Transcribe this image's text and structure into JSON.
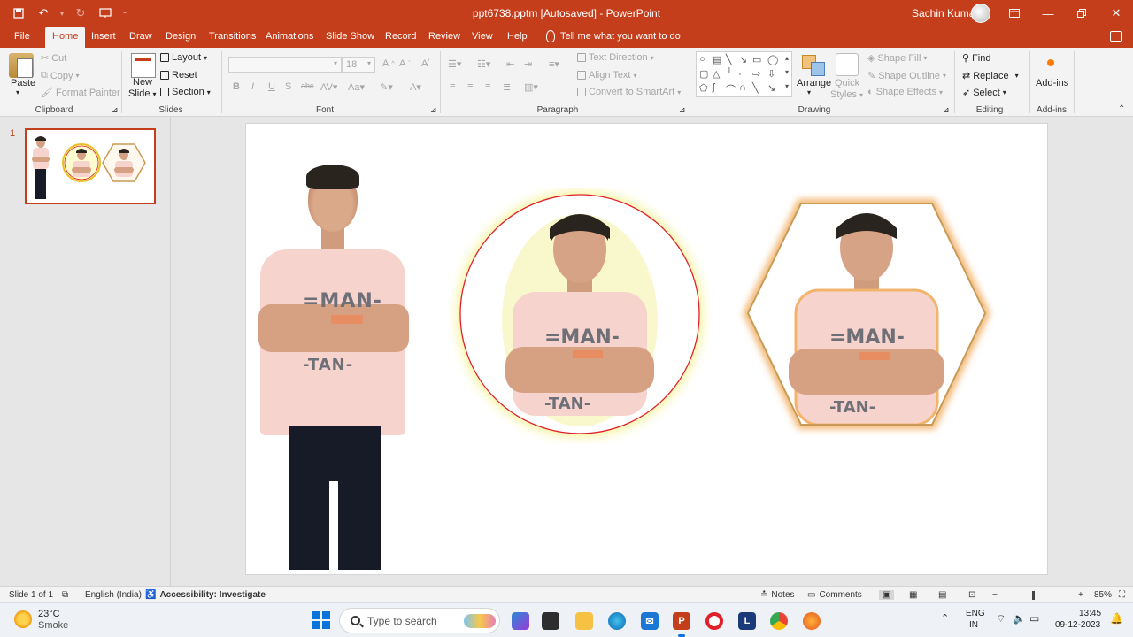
{
  "titlebar": {
    "title": "ppt6738.pptm [Autosaved]  -  PowerPoint",
    "user": "Sachin Kumar"
  },
  "tabs": [
    "File",
    "Home",
    "Insert",
    "Draw",
    "Design",
    "Transitions",
    "Animations",
    "Slide Show",
    "Record",
    "Review",
    "View",
    "Help"
  ],
  "tell_me": "Tell me what you want to do",
  "ribbon": {
    "clipboard": {
      "paste": "Paste",
      "cut": "Cut",
      "copy": "Copy",
      "format_painter": "Format Painter",
      "label": "Clipboard"
    },
    "slides": {
      "new_slide_1": "New",
      "new_slide_2": "Slide",
      "layout": "Layout",
      "reset": "Reset",
      "section": "Section",
      "label": "Slides"
    },
    "font": {
      "size": "18",
      "label": "Font"
    },
    "paragraph": {
      "text_direction": "Text Direction",
      "align_text": "Align Text",
      "convert_smartart": "Convert to SmartArt",
      "label": "Paragraph"
    },
    "drawing": {
      "arrange": "Arrange",
      "quick_1": "Quick",
      "quick_2": "Styles",
      "shape_fill": "Shape Fill",
      "shape_outline": "Shape Outline",
      "shape_effects": "Shape Effects",
      "label": "Drawing"
    },
    "editing": {
      "find": "Find",
      "replace": "Replace",
      "select": "Select",
      "label": "Editing"
    },
    "addins": {
      "button": "Add-ins",
      "label": "Add-ins"
    }
  },
  "panel": {
    "slide_number": "1"
  },
  "slide_shirt_text": {
    "line1": "=MAN-",
    "line2": "-TAN-"
  },
  "statusbar": {
    "slide_info": "Slide 1 of 1",
    "language": "English (India)",
    "accessibility": "Accessibility: Investigate",
    "notes": "Notes",
    "comments": "Comments",
    "zoom": "85%"
  },
  "taskbar": {
    "weather_temp": "23°C",
    "weather_desc": "Smoke",
    "search_placeholder": "Type to search",
    "lang_1": "ENG",
    "lang_2": "IN",
    "time": "13:45",
    "date": "09-12-2023"
  },
  "colors": {
    "accent": "#c43e1c",
    "circle_border": "#e0202a",
    "circle_glow": "#f3ee6a",
    "hexagon_border": "#c99a55",
    "hexagon_glow": "#f2b46d"
  }
}
